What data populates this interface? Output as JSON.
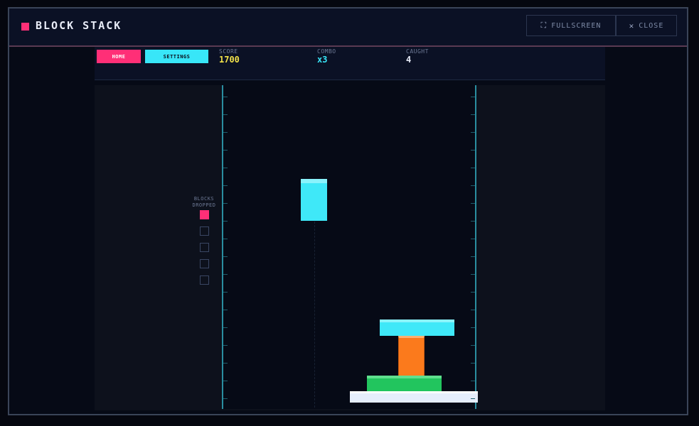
{
  "window": {
    "title": "BLOCK STACK",
    "fullscreen_label": "FULLSCREEN",
    "close_label": "CLOSE",
    "icons": {
      "fullscreen": "expand-icon",
      "close": "close-x-icon"
    }
  },
  "hud": {
    "home_label": "HOME",
    "settings_label": "SETTINGS",
    "score_label": "SCORE",
    "score_value": "1700",
    "combo_label": "COMBO",
    "combo_value": "x3",
    "caught_label": "CAUGHT",
    "caught_value": "4"
  },
  "side": {
    "blocks_dropped_label_1": "BLOCKS",
    "blocks_dropped_label_2": "DROPPED",
    "dropped_slots": [
      true,
      false,
      false,
      false,
      false
    ]
  },
  "colors": {
    "accent_pink": "#ff2f77",
    "accent_cyan": "#38e6f8",
    "score_yellow": "#f2e24a",
    "combo_cyan": "#38e6f8",
    "caught_white": "#e8ecf8",
    "block_cyan": "#3fe8f8",
    "block_orange": "#fb7a1c",
    "block_green": "#22c55e",
    "base_white": "#e6eefc"
  },
  "blocks": {
    "falling": {
      "color": "cyan",
      "shape": "vertical-bar"
    },
    "stack": [
      {
        "color": "white",
        "shape": "base-platform"
      },
      {
        "color": "green",
        "shape": "horizontal-slab"
      },
      {
        "color": "orange",
        "shape": "vertical-bar"
      },
      {
        "color": "cyan",
        "shape": "horizontal-slab"
      }
    ]
  }
}
